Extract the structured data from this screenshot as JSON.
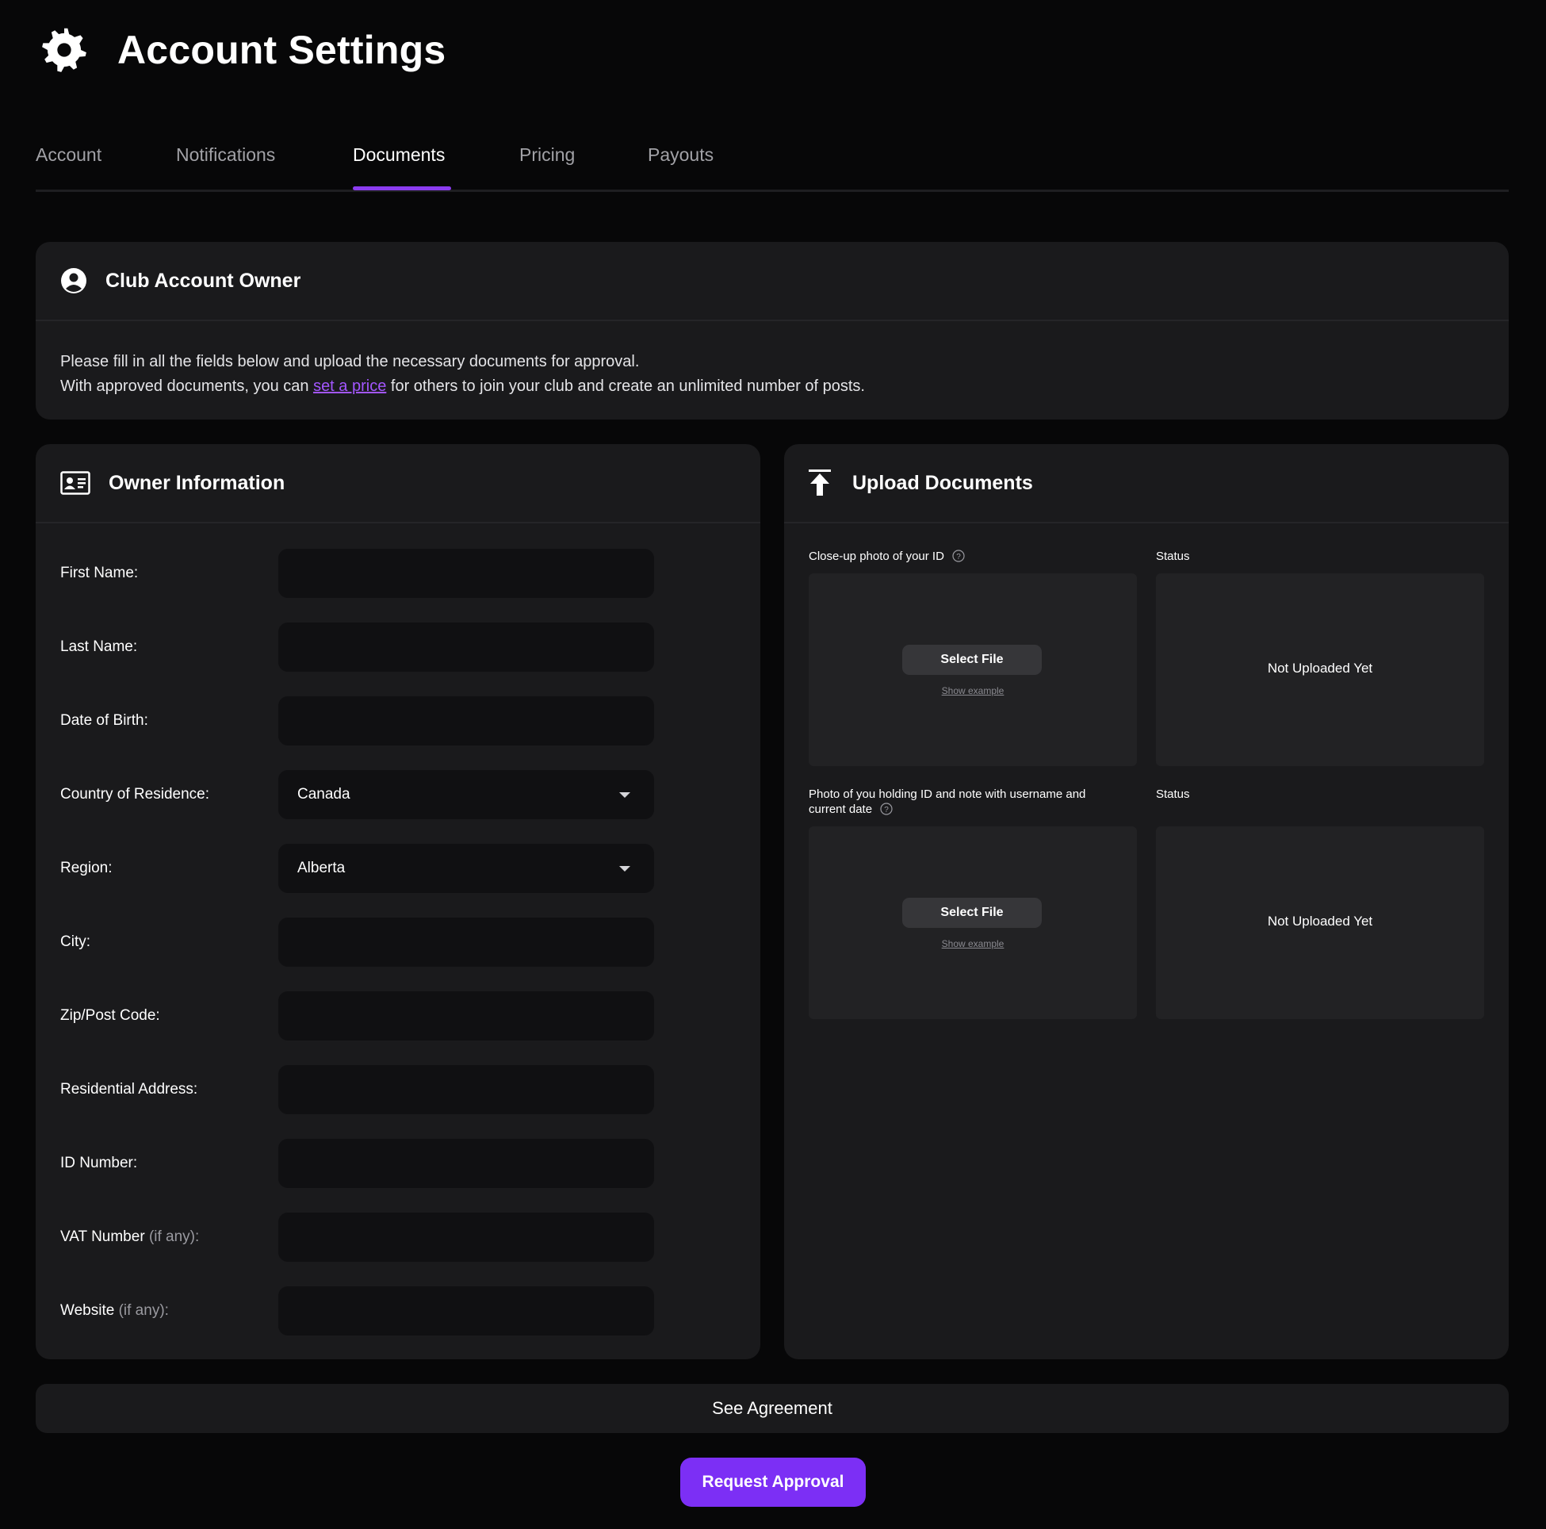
{
  "header": {
    "title": "Account Settings",
    "icon": "gear-icon"
  },
  "tabs": [
    {
      "label": "Account",
      "active": false
    },
    {
      "label": "Notifications",
      "active": false
    },
    {
      "label": "Documents",
      "active": true
    },
    {
      "label": "Pricing",
      "active": false
    },
    {
      "label": "Payouts",
      "active": false
    }
  ],
  "owner_card": {
    "title": "Club Account Owner",
    "icon": "user-circle-icon",
    "line1": "Please fill in all the fields below and upload the necessary documents for approval.",
    "line2_before": "With approved documents, you can ",
    "line2_link": "set a price",
    "line2_after": " for others to join your club and create an unlimited number of posts."
  },
  "owner_info": {
    "title": "Owner Information",
    "icon": "id-card-icon",
    "fields": {
      "first_name": {
        "label": "First Name:",
        "value": ""
      },
      "last_name": {
        "label": "Last Name:",
        "value": ""
      },
      "dob": {
        "label": "Date of Birth:",
        "value": ""
      },
      "country": {
        "label": "Country of Residence:",
        "value": "Canada"
      },
      "region": {
        "label": "Region:",
        "value": "Alberta"
      },
      "city": {
        "label": "City:",
        "value": ""
      },
      "zip": {
        "label": "Zip/Post Code:",
        "value": ""
      },
      "address": {
        "label": "Residential Address:",
        "value": ""
      },
      "id_number": {
        "label": "ID Number:",
        "value": ""
      },
      "vat": {
        "label": "VAT Number",
        "suffix": "(if any):",
        "value": ""
      },
      "website": {
        "label": "Website",
        "suffix": "(if any):",
        "value": ""
      }
    }
  },
  "upload": {
    "title": "Upload Documents",
    "icon": "upload-arrow-icon",
    "docs": [
      {
        "label": "Close-up photo of your ID",
        "status_label": "Status",
        "button": "Select File",
        "example": "Show example",
        "status": "Not Uploaded Yet"
      },
      {
        "label_line1": "Photo of you holding ID and note with username and",
        "label_line2": "current date",
        "status_label": "Status",
        "button": "Select File",
        "example": "Show example",
        "status": "Not Uploaded Yet"
      }
    ]
  },
  "actions": {
    "agreement": "See Agreement",
    "request": "Request Approval"
  },
  "colors": {
    "background": "#070708",
    "card": "#1a1a1c",
    "input": "#101012",
    "accent": "#7c2ff5",
    "link": "#a356ff"
  }
}
